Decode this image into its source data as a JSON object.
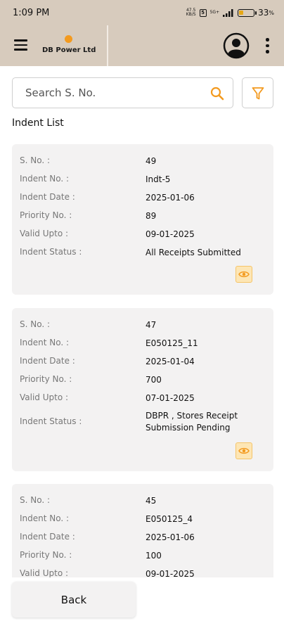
{
  "status_bar": {
    "time": "1:09 PM",
    "network_speed_top": "47.5",
    "network_speed_bottom": "KB/S",
    "sim_label": "5",
    "signal_label": "5G+",
    "battery_percent": "33",
    "battery_level": 0.33
  },
  "app_bar": {
    "logo_text": "DB Power Ltd",
    "icons": [
      "hamburger-menu-icon",
      "account-icon",
      "more-vert-icon"
    ],
    "brand_color": "#f39a1f",
    "bar_color": "#d7cbbd"
  },
  "search": {
    "placeholder": "Search S. No.",
    "value": "",
    "icon": "search-icon",
    "accent_color": "#f39a1f"
  },
  "filter": {
    "icon": "filter-icon"
  },
  "section_title": "Indent List",
  "labels": {
    "s_no": "S. No. :",
    "indent_no": "Indent No. :",
    "indent_date": "Indent Date :",
    "priority_no": "Priority No. :",
    "valid_upto": "Valid Upto :",
    "indent_status": "Indent Status :"
  },
  "indents": [
    {
      "s_no": "49",
      "indent_no": "Indt-5",
      "indent_date": "2025-01-06",
      "priority_no": "89",
      "valid_upto": "09-01-2025",
      "indent_status": "All Receipts Submitted"
    },
    {
      "s_no": "47",
      "indent_no": "E050125_11",
      "indent_date": "2025-01-04",
      "priority_no": "700",
      "valid_upto": "07-01-2025",
      "indent_status": "DBPR , Stores Receipt Submission Pending"
    },
    {
      "s_no": "45",
      "indent_no": "E050125_4",
      "indent_date": "2025-01-06",
      "priority_no": "100",
      "valid_upto": "09-01-2025",
      "indent_status": ""
    }
  ],
  "back_button": "Back"
}
